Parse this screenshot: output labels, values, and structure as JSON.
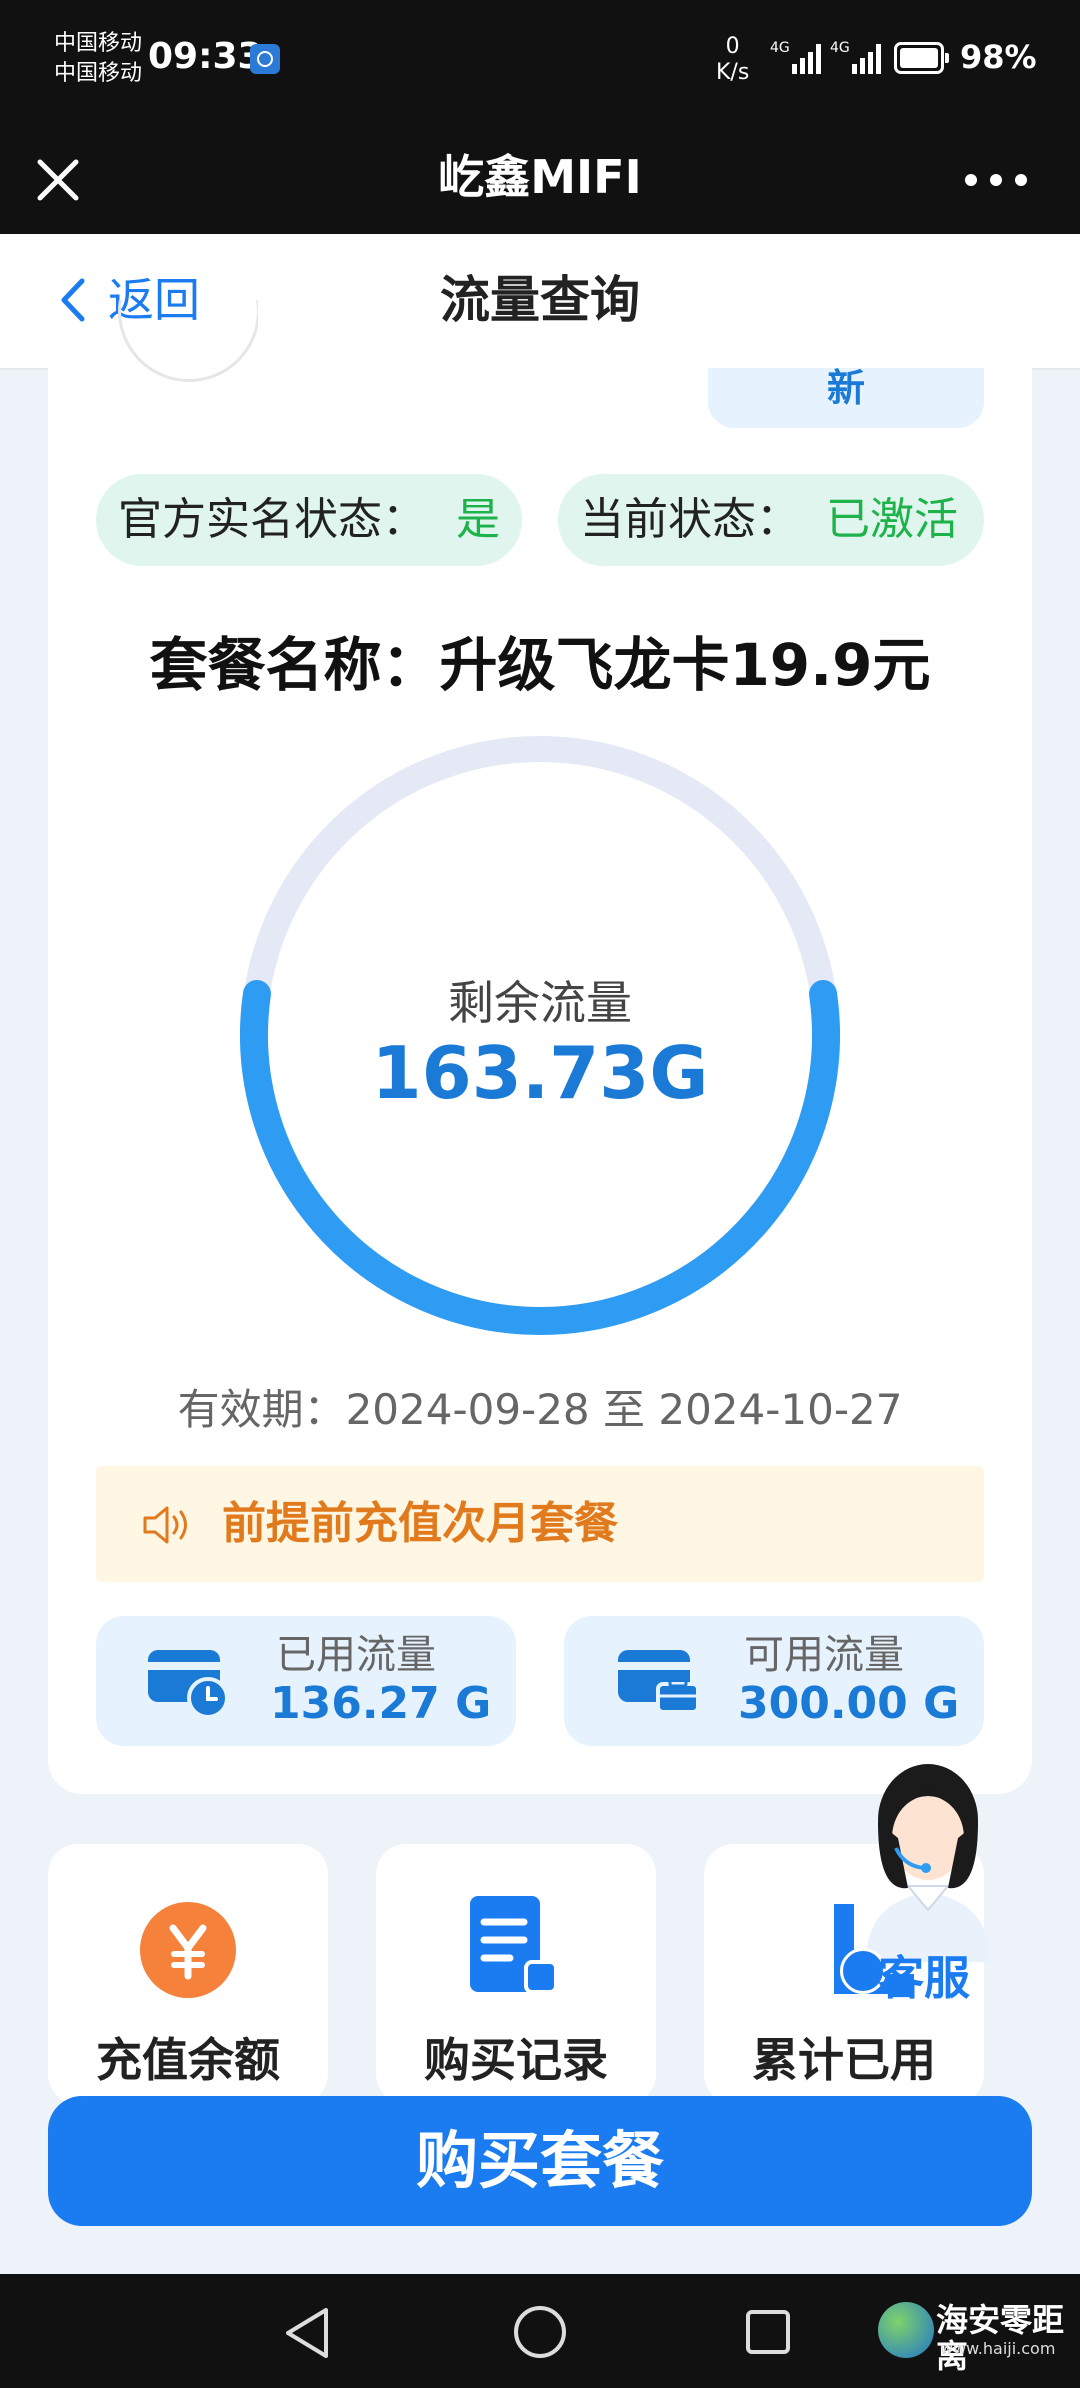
{
  "status_bar": {
    "carrier1": "中国移动",
    "carrier2": "中国移动",
    "time": "09:33",
    "net_speed_value": "0",
    "net_speed_unit": "K/s",
    "signal1": "4G",
    "signal2": "4G",
    "battery": "98%"
  },
  "titlebar": {
    "title": "屹鑫MIFI"
  },
  "navbar": {
    "back_label": "返回",
    "title": "流量查询"
  },
  "card": {
    "partial_top_label": "新",
    "realname_label": "官方实名状态：",
    "realname_value": "是",
    "status_label": "当前状态：",
    "status_value": "已激活",
    "package_name": "套餐名称：升级飞龙卡19.9元",
    "ring": {
      "label": "剩余流量",
      "value": "163.73G",
      "remaining_fraction": 0.5458
    },
    "validity": "有效期：2024-09-28 至 2024-10-27",
    "notice_text": "前提前充值次月套餐",
    "used": {
      "label": "已用流量",
      "value": "136.27 G"
    },
    "available": {
      "label": "可用流量",
      "value": "300.00 G"
    }
  },
  "tiles": [
    {
      "label": "充值余额",
      "icon": "yuan-icon"
    },
    {
      "label": "购买记录",
      "icon": "document-icon"
    },
    {
      "label": "累计已用",
      "icon": "chart-icon"
    }
  ],
  "support": {
    "label": "客服"
  },
  "buy_button": {
    "label": "购买套餐"
  },
  "watermark": {
    "name": "海安零距离",
    "url": "www.haiji.com"
  },
  "colors": {
    "accent": "#1a7cf0",
    "ring_track": "#e4e9f5",
    "ring_progress": "#2f9cf4",
    "green": "#1db34a",
    "notice_bg": "#fff6e3",
    "notice_text": "#e07a1c"
  }
}
